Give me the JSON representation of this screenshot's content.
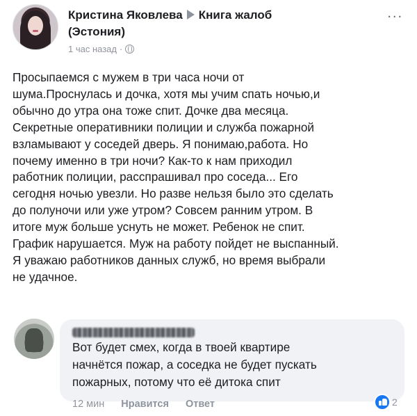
{
  "post": {
    "author": "Кристина Яковлева",
    "group_line1": "Книга жалоб",
    "group_line2": "(Эстония)",
    "time": "1 час назад",
    "privacy_icon": "globe-icon",
    "more_label": "...",
    "text": "Просыпаемся с мужем в три часа ночи от\nшума.Проснулась и дочка, хотя мы учим спать ночью,и\nобычно до утра она тоже спит. Дочке два месяца.\nСекретные оперативники полиции и служба пожарной\nвзламывают у соседей дверь. Я понимаю,работа. Но\nпочему именно в три ночи? Как-то к нам приходил\nработник полиции, расспрашивал про соседа... Его\nсегодня ночью увезли. Но разве нельзя было это сделать\nдо полуночи или уже утром?  Совсем ранним утром. В\nитоге муж больше уснуть не может. Ребенок не спит.\nГрафик нарушается. Муж на работу пойдет не выспанный.\nЯ уважаю работников данных служб, но время выбрали\nне удачное."
  },
  "comment": {
    "text": "Вот будет смех, когда в твоей квартире\nначнётся пожар, а соседка не будет пускать\nпожарных, потому что её дитока спит",
    "time": "12 мин",
    "like_label": "Нравится",
    "reply_label": "Ответ",
    "reaction_icon": "like-icon",
    "reaction_count": "2"
  },
  "colors": {
    "accent": "#1877f2",
    "meta_text": "#90949c",
    "bubble_bg": "#f0f2f5"
  }
}
